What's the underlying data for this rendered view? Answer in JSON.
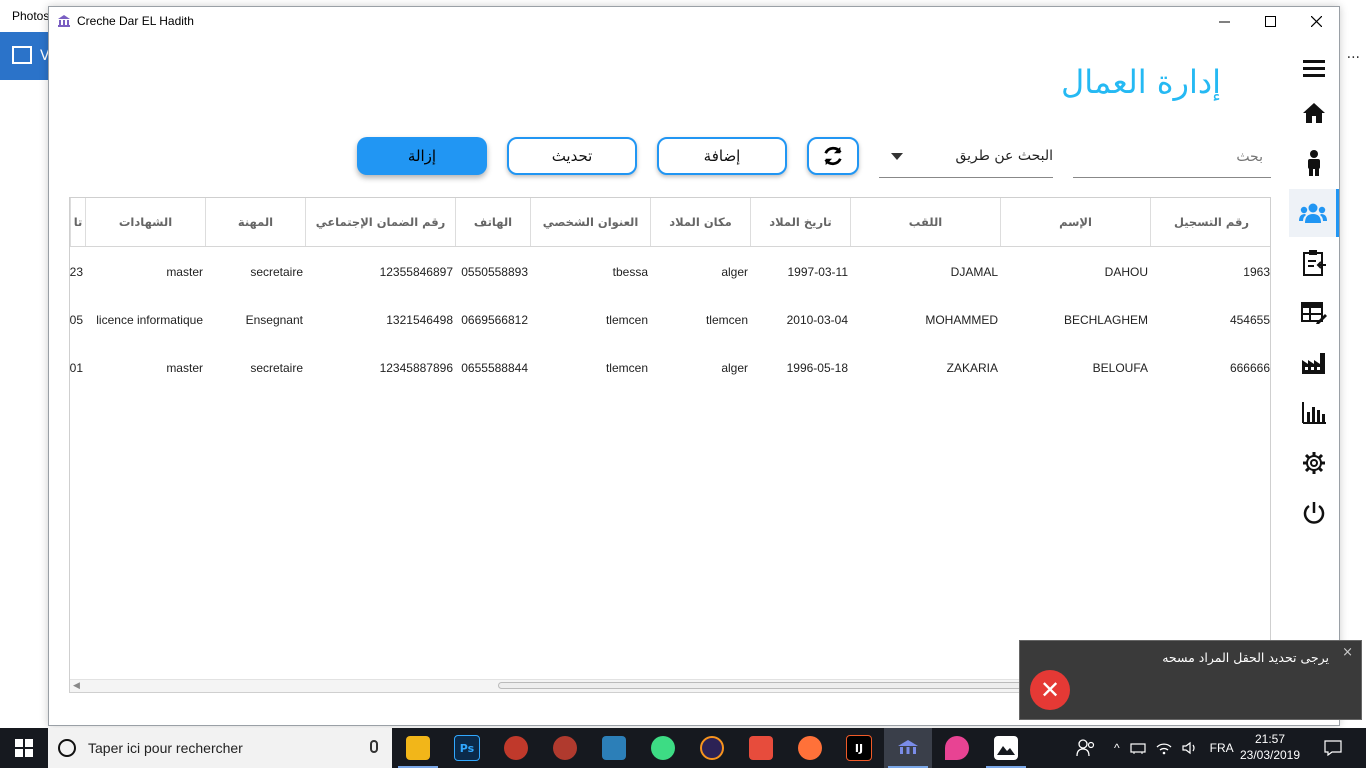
{
  "background_app": {
    "title": "Photos",
    "tab_initial": "V",
    "more": "..."
  },
  "window": {
    "title": "Creche Dar EL Hadith",
    "minimize": "—",
    "maximize": "☐",
    "close": "✕"
  },
  "page": {
    "title": "إدارة العمال"
  },
  "toolbar": {
    "search_placeholder": "بحث",
    "search_by_label": "البحث عن طريق",
    "add_label": "إضافة",
    "update_label": "تحديث",
    "remove_label": "إزالة"
  },
  "sidebar": {
    "items": [
      {
        "icon": "hamburger-menu-icon"
      },
      {
        "icon": "home-icon"
      },
      {
        "icon": "child-icon"
      },
      {
        "icon": "users-group-icon",
        "active": true
      },
      {
        "icon": "clipboard-icon"
      },
      {
        "icon": "edit-table-icon"
      },
      {
        "icon": "factory-icon"
      },
      {
        "icon": "bar-chart-icon"
      },
      {
        "icon": "gear-icon"
      },
      {
        "icon": "power-icon"
      }
    ]
  },
  "table": {
    "columns": [
      "رقم التسجيل",
      "الإسم",
      "اللقب",
      "تاريخ الملاد",
      "مكان الملاد",
      "العنوان الشخصي",
      "الهاتف",
      "رقم الضمان الإجتماعي",
      "المهنة",
      "الشهادات",
      "تا"
    ],
    "rows": [
      [
        "1963",
        "DAHOU",
        "DJAMAL",
        "1997-03-11",
        "alger",
        "tbessa",
        "0550558893",
        "12355846897",
        "secretaire",
        "master",
        "23"
      ],
      [
        "454655",
        "BECHLAGHEM",
        "MOHAMMED",
        "2010-03-04",
        "tlemcen",
        "tlemcen",
        "0669566812",
        "1321546498",
        "Ensegnant",
        "licence informatique",
        "05"
      ],
      [
        "666666",
        "BELOUFA",
        "ZAKARIA",
        "1996-05-18",
        "alger",
        "tlemcen",
        "0655588844",
        "12345887896",
        "secretaire",
        "master",
        "01"
      ]
    ]
  },
  "toast": {
    "message": "يرجى تحديد الحقل المراد مسحه",
    "close": "×",
    "icon": "error-icon"
  },
  "taskbar": {
    "search_placeholder": "Taper ici pour rechercher",
    "apps": [
      {
        "name": "file-explorer-icon",
        "color": "#f2b619"
      },
      {
        "name": "photoshop-icon",
        "label": "Ps",
        "color": "#0b2a4a"
      },
      {
        "name": "owl-app-icon",
        "color": "#c0392b"
      },
      {
        "name": "recorder-icon",
        "color": "#b03a2e"
      },
      {
        "name": "brackets-app-icon",
        "color": "#2c7fb8"
      },
      {
        "name": "android-studio-icon",
        "color": "#3ddc84"
      },
      {
        "name": "eclipse-icon",
        "color": "#2c2255"
      },
      {
        "name": "popcorn-icon",
        "color": "#e74c3c"
      },
      {
        "name": "firefox-icon",
        "color": "#ff7139"
      },
      {
        "name": "intellij-icon",
        "label": "IJ",
        "color": "#000000"
      },
      {
        "name": "creche-app-icon",
        "color": "#5e6bd8"
      },
      {
        "name": "paint-app-icon",
        "color": "#e84393"
      },
      {
        "name": "photos-app-icon",
        "color": "#ffffff"
      }
    ],
    "language": "FRA",
    "time": "21:57",
    "date": "23/03/2019"
  },
  "colors": {
    "accent": "#2196f3",
    "title": "#25b9f3",
    "toast_bg": "#3a3a3a",
    "error": "#e53935"
  }
}
